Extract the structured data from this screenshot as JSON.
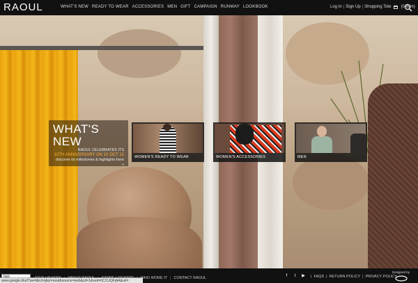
{
  "header": {
    "logo": "RAOUL",
    "nav": [
      "WHAT'S NEW",
      "READY TO WEAR",
      "ACCESSORIES",
      "MEN",
      "GIFT",
      "CAMPAIGN",
      "RUNWAY",
      "LOOKBOOK"
    ],
    "login": "Log In",
    "signup": "Sign Up",
    "tote": "Shopping Tote",
    "tote_count": "(0 item)"
  },
  "promo": {
    "title": "WHAT'S NEW",
    "line1": "RAOUL CELEBRATES ITS",
    "line2": "10TH ANNIVERSARY ON 10 OCT 12",
    "line3": "discover its milestones & highlights here »"
  },
  "tiles": [
    {
      "caption": "WOMEN'S READY TO WEAR"
    },
    {
      "caption": "WOMEN'S ACCESSORIES"
    },
    {
      "caption": "MEN"
    }
  ],
  "footer": {
    "lang_select": "Italy",
    "links": [
      "SIGN UP NOW",
      "ABOUT RAOUL",
      "STORE LOCATOR",
      "WHO WORE IT",
      "CONTACT RAOUL"
    ],
    "right_links": [
      "FAQS",
      "RETURN POLICY",
      "PRIVACY POLICY"
    ],
    "designed_by": "Designed by"
  },
  "statusbar": "www.google.it/url?sa=t&rct=j&q=raoul&source=web&cd=1&ved=0CCUQFjAA&url="
}
